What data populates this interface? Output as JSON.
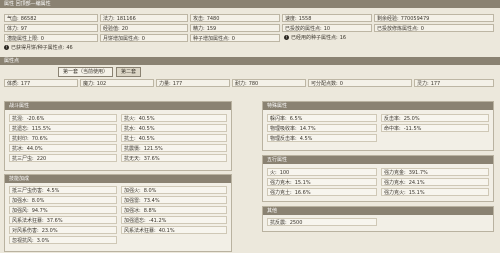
{
  "header": {
    "title": "属性 回顶部—编属性"
  },
  "top": {
    "row1": [
      {
        "label": "气血:",
        "value": "86582"
      },
      {
        "label": "法力:",
        "value": "181166"
      },
      {
        "label": "攻击:",
        "value": "7480"
      },
      {
        "label": "速度:",
        "value": "1558"
      },
      {
        "label": "剩余经验:",
        "value": "770059479"
      }
    ],
    "row2": [
      {
        "label": "体力:",
        "value": "97"
      },
      {
        "label": "经验值:",
        "value": "20"
      },
      {
        "label": "精力:",
        "value": "159"
      },
      {
        "label": "已投放的属性点:",
        "value": "10"
      },
      {
        "label": "已投放修炼属性点:",
        "value": "0"
      }
    ],
    "row3": [
      {
        "label": "潜能属性上限:",
        "value": "0"
      },
      {
        "label": "月饼增加属性点:",
        "value": "0"
      },
      {
        "label": "种子增加属性点:",
        "value": "0"
      }
    ],
    "row3_note": {
      "label": "已经用的种子属性点:",
      "value": "16"
    },
    "row4": {
      "label": "已获得月饼/种子属性点:",
      "value": "46"
    }
  },
  "attr_bar": {
    "title": "属性点"
  },
  "tabs": [
    {
      "label": "第一套（当前使用）"
    },
    {
      "label": "第二套"
    }
  ],
  "attrs": [
    {
      "label": "体质:",
      "value": "177"
    },
    {
      "label": "魔力:",
      "value": "102"
    },
    {
      "label": "力量:",
      "value": "177"
    },
    {
      "label": "耐力:",
      "value": "780"
    },
    {
      "label": "可分配点数:",
      "value": "0"
    },
    {
      "label": "灵力:",
      "value": "177"
    }
  ],
  "combat": {
    "title": "战斗属性",
    "rows": [
      [
        {
          "label": "抗混:",
          "value": "-20.6%"
        },
        {
          "label": "抗火:",
          "value": "40.5%"
        }
      ],
      [
        {
          "label": "抗遗忘:",
          "value": "115.5%"
        },
        {
          "label": "抗水:",
          "value": "40.5%"
        }
      ],
      [
        {
          "label": "抗封印:",
          "value": "70.6%"
        },
        {
          "label": "抗土:",
          "value": "40.5%"
        }
      ],
      [
        {
          "label": "抗冰:",
          "value": "44.0%"
        },
        {
          "label": "抗震慑:",
          "value": "121.5%"
        }
      ],
      [
        {
          "label": "抗三尸虫:",
          "value": "220"
        },
        {
          "label": "抗无天:",
          "value": "37.6%"
        }
      ]
    ]
  },
  "skill": {
    "title": "技能加成",
    "rows": [
      [
        {
          "label": "抵三尸虫伤害:",
          "value": "4.5%"
        },
        {
          "label": "加强火:",
          "value": "8.0%"
        }
      ],
      [
        {
          "label": "加强水:",
          "value": "8.0%"
        },
        {
          "label": "加强雷:",
          "value": "73.4%"
        }
      ],
      [
        {
          "label": "加强风:",
          "value": "94.7%"
        },
        {
          "label": "加强冰:",
          "value": "8.8%"
        }
      ],
      [
        {
          "label": "风系法术狂暴:",
          "value": "37.6%"
        },
        {
          "label": "加强遗忘:",
          "value": "-41.2%"
        }
      ],
      [
        {
          "label": "对风系伤害:",
          "value": "23.0%"
        },
        {
          "label": "风系法术狂暴:",
          "value": "40.1%"
        }
      ],
      [
        {
          "label": "忽视抗风:",
          "value": "3.0%"
        }
      ]
    ]
  },
  "special": {
    "title": "特殊属性",
    "rows": [
      [
        {
          "label": "躲闪率:",
          "value": "6.5%"
        },
        {
          "label": "反击率:",
          "value": "25.0%"
        }
      ],
      [
        {
          "label": "物理吸收率:",
          "value": "14.7%"
        },
        {
          "label": "命中率:",
          "value": "-11.5%"
        }
      ],
      [
        {
          "label": "物理反击率:",
          "value": "4.5%"
        }
      ]
    ]
  },
  "five": {
    "title": "五行属性",
    "rows": [
      [
        {
          "label": "火:",
          "value": "100"
        },
        {
          "label": "强力克金:",
          "value": "391.7%"
        }
      ],
      [
        {
          "label": "强力克木:",
          "value": "15.1%"
        },
        {
          "label": "强力克水:",
          "value": "24.1%"
        }
      ],
      [
        {
          "label": "强力克土:",
          "value": "16.6%"
        },
        {
          "label": "强力克火:",
          "value": "15.1%"
        }
      ]
    ]
  },
  "other": {
    "title": "其他",
    "rows": [
      [
        {
          "label": "抗反震:",
          "value": "2500"
        }
      ]
    ]
  }
}
